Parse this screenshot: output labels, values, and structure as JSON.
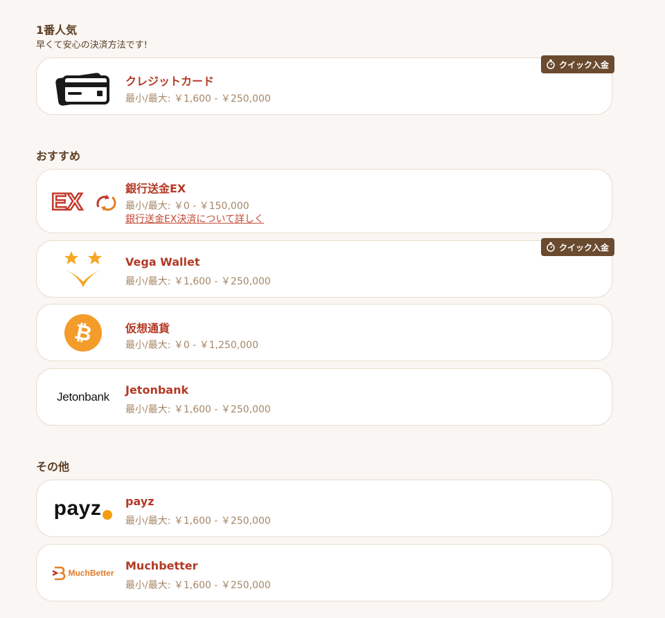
{
  "sections": {
    "popular": {
      "title": "1番人気",
      "subtitle": "早くて安心の決済方法です!"
    },
    "recommended": {
      "title": "おすすめ"
    },
    "other": {
      "title": "その他"
    }
  },
  "quick_deposit_label": "クイック入金",
  "methods": [
    {
      "name": "クレジットカード",
      "range": "最小/最大: ￥1,600 - ￥250,000",
      "icon": "credit-card-icon",
      "quick": true
    },
    {
      "name": "銀行送金EX",
      "range": "最小/最大: ￥0 - ￥150,000",
      "link": "銀行送金EX決済について詳しく",
      "icon": "ex-logo",
      "logo_text": "EX"
    },
    {
      "name": "Vega Wallet",
      "range": "最小/最大: ￥1,600 - ￥250,000",
      "icon": "vega-wallet-logo",
      "quick": true
    },
    {
      "name": "仮想通貨",
      "range": "最小/最大: ￥0 - ￥1,250,000",
      "icon": "bitcoin-icon",
      "logo_text": "₿"
    },
    {
      "name": "Jetonbank",
      "range": "最小/最大: ￥1,600 - ￥250,000",
      "icon": "jetonbank-logo",
      "logo_text": "Jetonbank"
    },
    {
      "name": "payz",
      "range": "最小/最大: ￥1,600 - ￥250,000",
      "icon": "payz-logo",
      "logo_text": "payz"
    },
    {
      "name": "Muchbetter",
      "range": "最小/最大: ￥1,600 - ￥250,000",
      "icon": "muchbetter-logo",
      "logo_text": "MuchBetter"
    }
  ],
  "colors": {
    "background": "#f9f6f3",
    "method_name": "#b33a26",
    "range_text": "#a58667",
    "badge_bg": "#6b4b30",
    "bitcoin": "#f39c2a"
  }
}
